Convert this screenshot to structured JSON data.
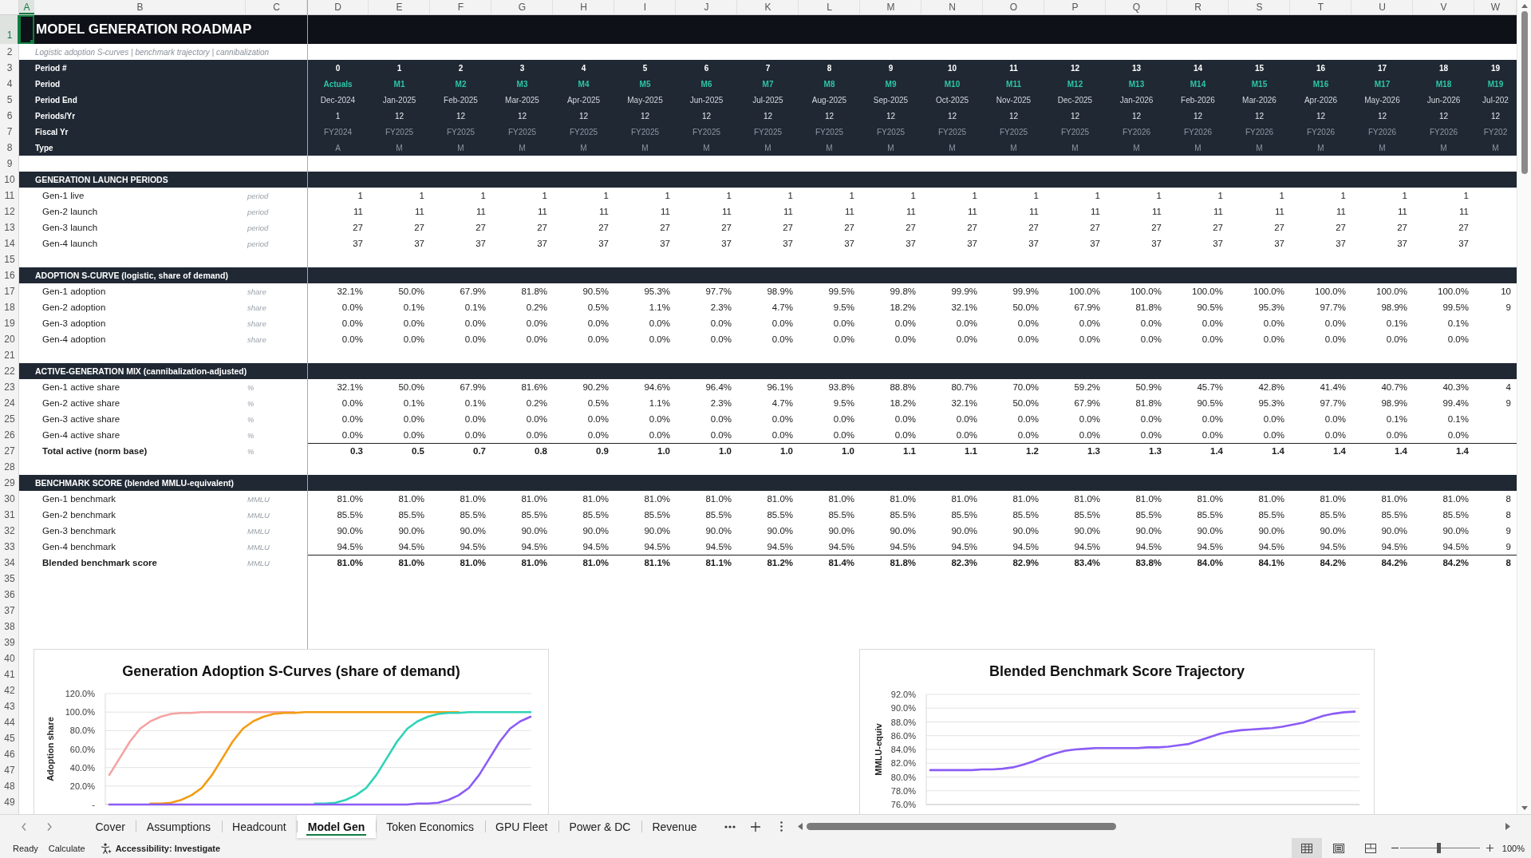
{
  "sheet": {
    "column_headers": [
      {
        "label": "A",
        "selected": true
      },
      {
        "label": "B",
        "selected": false
      },
      {
        "label": "C",
        "selected": false
      },
      {
        "label": "D",
        "selected": false
      },
      {
        "label": "E",
        "selected": false
      },
      {
        "label": "F",
        "selected": false
      },
      {
        "label": "G",
        "selected": false
      },
      {
        "label": "H",
        "selected": false
      },
      {
        "label": "I",
        "selected": false
      },
      {
        "label": "J",
        "selected": false
      },
      {
        "label": "K",
        "selected": false
      },
      {
        "label": "L",
        "selected": false
      },
      {
        "label": "M",
        "selected": false
      },
      {
        "label": "N",
        "selected": false
      },
      {
        "label": "O",
        "selected": false
      },
      {
        "label": "P",
        "selected": false
      },
      {
        "label": "Q",
        "selected": false
      },
      {
        "label": "R",
        "selected": false
      },
      {
        "label": "S",
        "selected": false
      },
      {
        "label": "T",
        "selected": false
      },
      {
        "label": "U",
        "selected": false
      },
      {
        "label": "V",
        "selected": false
      },
      {
        "label": "W",
        "selected": false
      }
    ],
    "row_headers": [
      {
        "label": "1",
        "selected": true
      },
      {
        "label": "2",
        "selected": false
      },
      {
        "label": "3",
        "selected": false
      },
      {
        "label": "4",
        "selected": false
      },
      {
        "label": "5",
        "selected": false
      },
      {
        "label": "6",
        "selected": false
      },
      {
        "label": "7",
        "selected": false
      },
      {
        "label": "8",
        "selected": false
      },
      {
        "label": "9",
        "selected": false
      },
      {
        "label": "10",
        "selected": false
      },
      {
        "label": "11",
        "selected": false
      },
      {
        "label": "12",
        "selected": false
      },
      {
        "label": "13",
        "selected": false
      },
      {
        "label": "14",
        "selected": false
      },
      {
        "label": "15",
        "selected": false
      },
      {
        "label": "16",
        "selected": false
      },
      {
        "label": "17",
        "selected": false
      },
      {
        "label": "18",
        "selected": false
      },
      {
        "label": "19",
        "selected": false
      },
      {
        "label": "20",
        "selected": false
      },
      {
        "label": "21",
        "selected": false
      },
      {
        "label": "22",
        "selected": false
      },
      {
        "label": "23",
        "selected": false
      },
      {
        "label": "24",
        "selected": false
      },
      {
        "label": "25",
        "selected": false
      },
      {
        "label": "26",
        "selected": false
      },
      {
        "label": "27",
        "selected": false
      },
      {
        "label": "28",
        "selected": false
      },
      {
        "label": "29",
        "selected": false
      },
      {
        "label": "30",
        "selected": false
      },
      {
        "label": "31",
        "selected": false
      },
      {
        "label": "32",
        "selected": false
      },
      {
        "label": "33",
        "selected": false
      },
      {
        "label": "34",
        "selected": false
      },
      {
        "label": "35",
        "selected": false
      },
      {
        "label": "36",
        "selected": false
      },
      {
        "label": "37",
        "selected": false
      },
      {
        "label": "38",
        "selected": false
      },
      {
        "label": "39",
        "selected": false
      },
      {
        "label": "40",
        "selected": false
      },
      {
        "label": "41",
        "selected": false
      },
      {
        "label": "42",
        "selected": false
      },
      {
        "label": "43",
        "selected": false
      },
      {
        "label": "44",
        "selected": false
      },
      {
        "label": "45",
        "selected": false
      },
      {
        "label": "46",
        "selected": false
      },
      {
        "label": "47",
        "selected": false
      },
      {
        "label": "48",
        "selected": false
      },
      {
        "label": "49",
        "selected": false
      }
    ],
    "title": "MODEL GENERATION ROADMAP",
    "subtitle": "Logistic adoption S-curves | benchmark trajectory | cannibalization",
    "period_rows": [
      {
        "kind": "index",
        "label": "Period #",
        "values": [
          "0",
          "1",
          "2",
          "3",
          "4",
          "5",
          "6",
          "7",
          "8",
          "9",
          "10",
          "11",
          "12",
          "13",
          "14",
          "15",
          "16",
          "17",
          "18",
          "19"
        ]
      },
      {
        "kind": "period",
        "label": "Period",
        "values": [
          "Actuals",
          "M1",
          "M2",
          "M3",
          "M4",
          "M5",
          "M6",
          "M7",
          "M8",
          "M9",
          "M10",
          "M11",
          "M12",
          "M13",
          "M14",
          "M15",
          "M16",
          "M17",
          "M18",
          "M19"
        ]
      },
      {
        "kind": "date",
        "label": "Period End",
        "values": [
          "Dec-2024",
          "Jan-2025",
          "Feb-2025",
          "Mar-2025",
          "Apr-2025",
          "May-2025",
          "Jun-2025",
          "Jul-2025",
          "Aug-2025",
          "Sep-2025",
          "Oct-2025",
          "Nov-2025",
          "Dec-2025",
          "Jan-2026",
          "Feb-2026",
          "Mar-2026",
          "Apr-2026",
          "May-2026",
          "Jun-2026",
          "Jul-202"
        ]
      },
      {
        "kind": "count",
        "label": "Periods/Yr",
        "values": [
          "1",
          "12",
          "12",
          "12",
          "12",
          "12",
          "12",
          "12",
          "12",
          "12",
          "12",
          "12",
          "12",
          "12",
          "12",
          "12",
          "12",
          "12",
          "12",
          "12"
        ]
      },
      {
        "kind": "fiscal",
        "label": "Fiscal Yr",
        "values": [
          "FY2024",
          "FY2025",
          "FY2025",
          "FY2025",
          "FY2025",
          "FY2025",
          "FY2025",
          "FY2025",
          "FY2025",
          "FY2025",
          "FY2025",
          "FY2025",
          "FY2025",
          "FY2026",
          "FY2026",
          "FY2026",
          "FY2026",
          "FY2026",
          "FY2026",
          "FY202"
        ]
      },
      {
        "kind": "type",
        "label": "Type",
        "values": [
          "A",
          "M",
          "M",
          "M",
          "M",
          "M",
          "M",
          "M",
          "M",
          "M",
          "M",
          "M",
          "M",
          "M",
          "M",
          "M",
          "M",
          "M",
          "M",
          "M"
        ]
      }
    ],
    "sections": [
      {
        "title": "GENERATION LAUNCH PERIODS",
        "rows": [
          {
            "kind": "item",
            "label": "Gen-1 live",
            "unit": "period",
            "values": [
              "1",
              "1",
              "1",
              "1",
              "1",
              "1",
              "1",
              "1",
              "1",
              "1",
              "1",
              "1",
              "1",
              "1",
              "1",
              "1",
              "1",
              "1",
              "1"
            ]
          },
          {
            "kind": "item",
            "label": "Gen-2 launch",
            "unit": "period",
            "values": [
              "11",
              "11",
              "11",
              "11",
              "11",
              "11",
              "11",
              "11",
              "11",
              "11",
              "11",
              "11",
              "11",
              "11",
              "11",
              "11",
              "11",
              "11",
              "11"
            ]
          },
          {
            "kind": "item",
            "label": "Gen-3 launch",
            "unit": "period",
            "values": [
              "27",
              "27",
              "27",
              "27",
              "27",
              "27",
              "27",
              "27",
              "27",
              "27",
              "27",
              "27",
              "27",
              "27",
              "27",
              "27",
              "27",
              "27",
              "27"
            ]
          },
          {
            "kind": "item",
            "label": "Gen-4 launch",
            "unit": "period",
            "values": [
              "37",
              "37",
              "37",
              "37",
              "37",
              "37",
              "37",
              "37",
              "37",
              "37",
              "37",
              "37",
              "37",
              "37",
              "37",
              "37",
              "37",
              "37",
              "37"
            ]
          }
        ]
      },
      {
        "title": "ADOPTION S-CURVE (logistic, share of demand)",
        "rows": [
          {
            "kind": "item",
            "label": "Gen-1 adoption",
            "unit": "share",
            "values": [
              "32.1%",
              "50.0%",
              "67.9%",
              "81.8%",
              "90.5%",
              "95.3%",
              "97.7%",
              "98.9%",
              "99.5%",
              "99.8%",
              "99.9%",
              "99.9%",
              "100.0%",
              "100.0%",
              "100.0%",
              "100.0%",
              "100.0%",
              "100.0%",
              "100.0%",
              "10"
            ]
          },
          {
            "kind": "item",
            "label": "Gen-2 adoption",
            "unit": "share",
            "values": [
              "0.0%",
              "0.1%",
              "0.1%",
              "0.2%",
              "0.5%",
              "1.1%",
              "2.3%",
              "4.7%",
              "9.5%",
              "18.2%",
              "32.1%",
              "50.0%",
              "67.9%",
              "81.8%",
              "90.5%",
              "95.3%",
              "97.7%",
              "98.9%",
              "99.5%",
              "9"
            ]
          },
          {
            "kind": "item",
            "label": "Gen-3 adoption",
            "unit": "share",
            "values": [
              "0.0%",
              "0.0%",
              "0.0%",
              "0.0%",
              "0.0%",
              "0.0%",
              "0.0%",
              "0.0%",
              "0.0%",
              "0.0%",
              "0.0%",
              "0.0%",
              "0.0%",
              "0.0%",
              "0.0%",
              "0.0%",
              "0.0%",
              "0.1%",
              "0.1%"
            ]
          },
          {
            "kind": "item",
            "label": "Gen-4 adoption",
            "unit": "share",
            "values": [
              "0.0%",
              "0.0%",
              "0.0%",
              "0.0%",
              "0.0%",
              "0.0%",
              "0.0%",
              "0.0%",
              "0.0%",
              "0.0%",
              "0.0%",
              "0.0%",
              "0.0%",
              "0.0%",
              "0.0%",
              "0.0%",
              "0.0%",
              "0.0%",
              "0.0%"
            ]
          }
        ]
      },
      {
        "title": "ACTIVE-GENERATION MIX (cannibalization-adjusted)",
        "rows": [
          {
            "kind": "item",
            "label": "Gen-1 active share",
            "unit": "%",
            "values": [
              "32.1%",
              "50.0%",
              "67.9%",
              "81.6%",
              "90.2%",
              "94.6%",
              "96.4%",
              "96.1%",
              "93.8%",
              "88.8%",
              "80.7%",
              "70.0%",
              "59.2%",
              "50.9%",
              "45.7%",
              "42.8%",
              "41.4%",
              "40.7%",
              "40.3%",
              "4"
            ]
          },
          {
            "kind": "item",
            "label": "Gen-2 active share",
            "unit": "%",
            "values": [
              "0.0%",
              "0.1%",
              "0.1%",
              "0.2%",
              "0.5%",
              "1.1%",
              "2.3%",
              "4.7%",
              "9.5%",
              "18.2%",
              "32.1%",
              "50.0%",
              "67.9%",
              "81.8%",
              "90.5%",
              "95.3%",
              "97.7%",
              "98.9%",
              "99.4%",
              "9"
            ]
          },
          {
            "kind": "item",
            "label": "Gen-3 active share",
            "unit": "%",
            "values": [
              "0.0%",
              "0.0%",
              "0.0%",
              "0.0%",
              "0.0%",
              "0.0%",
              "0.0%",
              "0.0%",
              "0.0%",
              "0.0%",
              "0.0%",
              "0.0%",
              "0.0%",
              "0.0%",
              "0.0%",
              "0.0%",
              "0.0%",
              "0.1%",
              "0.1%"
            ]
          },
          {
            "kind": "item",
            "label": "Gen-4 active share",
            "unit": "%",
            "values": [
              "0.0%",
              "0.0%",
              "0.0%",
              "0.0%",
              "0.0%",
              "0.0%",
              "0.0%",
              "0.0%",
              "0.0%",
              "0.0%",
              "0.0%",
              "0.0%",
              "0.0%",
              "0.0%",
              "0.0%",
              "0.0%",
              "0.0%",
              "0.0%",
              "0.0%"
            ]
          },
          {
            "kind": "total",
            "label": "Total active (norm base)",
            "unit": "%",
            "values": [
              "0.3",
              "0.5",
              "0.7",
              "0.8",
              "0.9",
              "1.0",
              "1.0",
              "1.0",
              "1.0",
              "1.1",
              "1.1",
              "1.2",
              "1.3",
              "1.3",
              "1.4",
              "1.4",
              "1.4",
              "1.4",
              "1.4"
            ]
          }
        ]
      },
      {
        "title": "BENCHMARK SCORE (blended MMLU-equivalent)",
        "rows": [
          {
            "kind": "item",
            "label": "Gen-1 benchmark",
            "unit": "MMLU",
            "values": [
              "81.0%",
              "81.0%",
              "81.0%",
              "81.0%",
              "81.0%",
              "81.0%",
              "81.0%",
              "81.0%",
              "81.0%",
              "81.0%",
              "81.0%",
              "81.0%",
              "81.0%",
              "81.0%",
              "81.0%",
              "81.0%",
              "81.0%",
              "81.0%",
              "81.0%",
              "8"
            ]
          },
          {
            "kind": "item",
            "label": "Gen-2 benchmark",
            "unit": "MMLU",
            "values": [
              "85.5%",
              "85.5%",
              "85.5%",
              "85.5%",
              "85.5%",
              "85.5%",
              "85.5%",
              "85.5%",
              "85.5%",
              "85.5%",
              "85.5%",
              "85.5%",
              "85.5%",
              "85.5%",
              "85.5%",
              "85.5%",
              "85.5%",
              "85.5%",
              "85.5%",
              "8"
            ]
          },
          {
            "kind": "item",
            "label": "Gen-3 benchmark",
            "unit": "MMLU",
            "values": [
              "90.0%",
              "90.0%",
              "90.0%",
              "90.0%",
              "90.0%",
              "90.0%",
              "90.0%",
              "90.0%",
              "90.0%",
              "90.0%",
              "90.0%",
              "90.0%",
              "90.0%",
              "90.0%",
              "90.0%",
              "90.0%",
              "90.0%",
              "90.0%",
              "90.0%",
              "9"
            ]
          },
          {
            "kind": "item",
            "label": "Gen-4 benchmark",
            "unit": "MMLU",
            "values": [
              "94.5%",
              "94.5%",
              "94.5%",
              "94.5%",
              "94.5%",
              "94.5%",
              "94.5%",
              "94.5%",
              "94.5%",
              "94.5%",
              "94.5%",
              "94.5%",
              "94.5%",
              "94.5%",
              "94.5%",
              "94.5%",
              "94.5%",
              "94.5%",
              "94.5%",
              "9"
            ]
          },
          {
            "kind": "total",
            "label": "Blended benchmark score",
            "unit": "MMLU",
            "values": [
              "81.0%",
              "81.0%",
              "81.0%",
              "81.0%",
              "81.0%",
              "81.1%",
              "81.1%",
              "81.2%",
              "81.4%",
              "81.8%",
              "82.3%",
              "82.9%",
              "83.4%",
              "83.8%",
              "84.0%",
              "84.1%",
              "84.2%",
              "84.2%",
              "84.2%",
              "8"
            ]
          }
        ]
      }
    ]
  },
  "charts": [
    {
      "chart_data": {
        "type": "line",
        "title": "Generation Adoption S-Curves (share of demand)",
        "ylabel": "Adoption share",
        "ylim": [
          0,
          120
        ],
        "yticks": [
          {
            "value": 0,
            "label": "-"
          },
          {
            "value": 20,
            "label": "20.0%"
          },
          {
            "value": 40,
            "label": "40.0%"
          },
          {
            "value": 60,
            "label": "60.0%"
          },
          {
            "value": 80,
            "label": "80.0%"
          },
          {
            "value": 100,
            "label": "100.0%"
          },
          {
            "value": 120,
            "label": "120.0%"
          }
        ],
        "grid": true,
        "series": [
          {
            "color": "#f4a3a3",
            "values": [
              32,
              50,
              68,
              82,
              90,
              95,
              98,
              99,
              99,
              100,
              100,
              100,
              100,
              100,
              100,
              100,
              100,
              100,
              100,
              null,
              null,
              null,
              null,
              null,
              null,
              null,
              null,
              null,
              null,
              null,
              null,
              null,
              null,
              null,
              null,
              null,
              null,
              null,
              null,
              null,
              null,
              null
            ]
          },
          {
            "color": "#f39c12",
            "values": [
              null,
              null,
              null,
              null,
              1,
              1,
              2,
              5,
              10,
              18,
              32,
              50,
              68,
              82,
              90,
              95,
              98,
              99,
              99,
              100,
              100,
              100,
              100,
              100,
              100,
              100,
              100,
              100,
              100,
              100,
              100,
              100,
              100,
              100,
              100,
              null,
              null,
              null,
              null,
              null,
              null,
              null
            ]
          },
          {
            "color": "#2ed3b7",
            "values": [
              null,
              null,
              null,
              null,
              null,
              null,
              null,
              null,
              null,
              null,
              null,
              null,
              null,
              null,
              null,
              null,
              null,
              null,
              null,
              null,
              1,
              1,
              2,
              5,
              10,
              18,
              32,
              50,
              68,
              82,
              90,
              95,
              98,
              99,
              99,
              100,
              100,
              100,
              100,
              100,
              100,
              100
            ]
          },
          {
            "color": "#8b5cf6",
            "values": [
              0,
              0,
              0,
              0,
              0,
              0,
              0,
              0,
              0,
              0,
              0,
              0,
              0,
              0,
              0,
              0,
              0,
              0,
              0,
              0,
              0,
              0,
              0,
              0,
              0,
              0,
              0,
              0,
              0,
              0,
              1,
              1,
              2,
              5,
              10,
              18,
              32,
              50,
              68,
              82,
              90,
              95
            ]
          }
        ]
      }
    },
    {
      "chart_data": {
        "type": "line",
        "title": "Blended Benchmark Score Trajectory",
        "ylabel": "MMLU-equiv",
        "ylim": [
          76,
          92
        ],
        "yticks": [
          {
            "value": 76,
            "label": "76.0%"
          },
          {
            "value": 78,
            "label": "78.0%"
          },
          {
            "value": 80,
            "label": "80.0%"
          },
          {
            "value": 82,
            "label": "82.0%"
          },
          {
            "value": 84,
            "label": "84.0%"
          },
          {
            "value": 86,
            "label": "86.0%"
          },
          {
            "value": 88,
            "label": "88.0%"
          },
          {
            "value": 90,
            "label": "90.0%"
          },
          {
            "value": 92,
            "label": "92.0%"
          }
        ],
        "grid": true,
        "series": [
          {
            "color": "#8b5cf6",
            "values": [
              81.0,
              81.0,
              81.0,
              81.0,
              81.0,
              81.1,
              81.1,
              81.2,
              81.4,
              81.8,
              82.3,
              82.9,
              83.4,
              83.8,
              84.0,
              84.1,
              84.2,
              84.2,
              84.2,
              84.2,
              84.2,
              84.3,
              84.3,
              84.4,
              84.6,
              84.8,
              85.3,
              85.8,
              86.3,
              86.6,
              86.8,
              86.9,
              87.0,
              87.1,
              87.3,
              87.6,
              87.9,
              88.4,
              88.9,
              89.2,
              89.4,
              89.5
            ]
          }
        ]
      }
    }
  ],
  "sheet_tabs": [
    {
      "label": "Cover",
      "selected": false
    },
    {
      "label": "Assumptions",
      "selected": false
    },
    {
      "label": "Headcount",
      "selected": false
    },
    {
      "label": "Model Gen",
      "selected": true
    },
    {
      "label": "Token Economics",
      "selected": false
    },
    {
      "label": "GPU Fleet",
      "selected": false
    },
    {
      "label": "Power & DC",
      "selected": false
    },
    {
      "label": "Revenue",
      "selected": false
    }
  ],
  "status_bar": {
    "status_texts": [
      "Ready",
      "Calculate"
    ],
    "accessibility": "Accessibility: Investigate",
    "views": [
      {
        "kind": "normal",
        "selected": true
      },
      {
        "kind": "page_layout",
        "selected": false
      },
      {
        "kind": "page_break",
        "selected": false
      }
    ],
    "zoom": {
      "level": 0.48,
      "label": "100%"
    }
  }
}
